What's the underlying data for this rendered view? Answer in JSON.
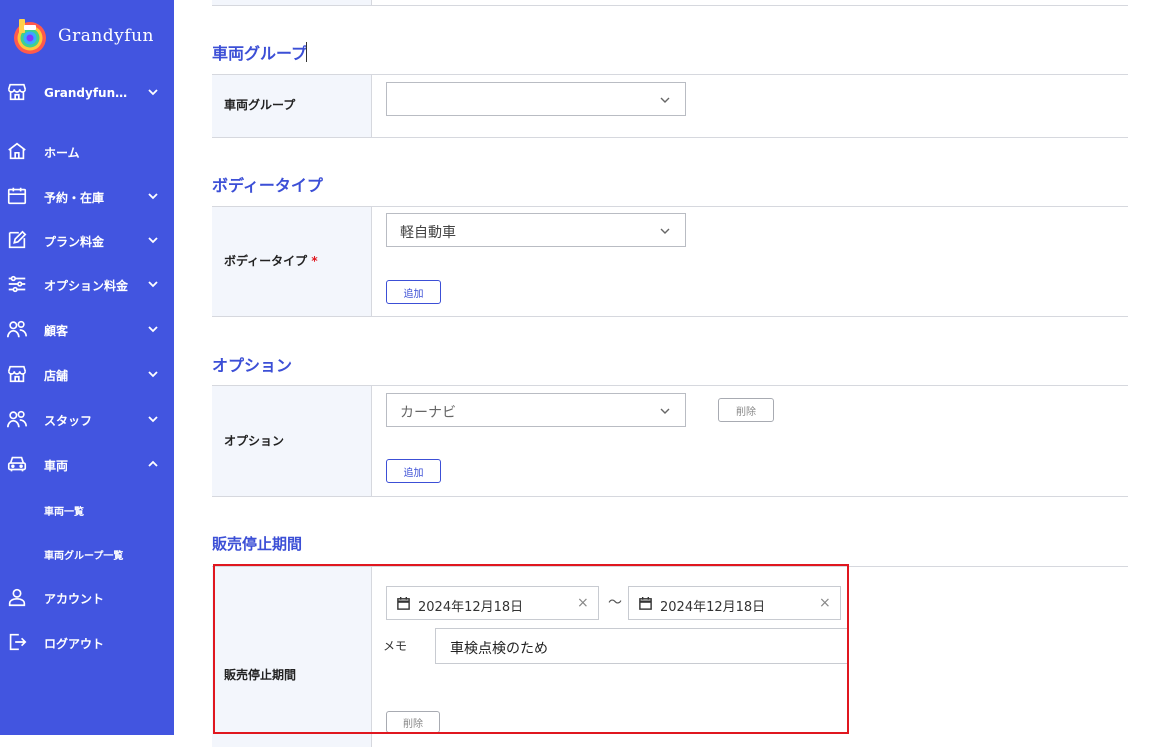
{
  "app": {
    "logo_text": "Grandyfun"
  },
  "sidebar": {
    "store": {
      "label": "Grandyfun…"
    },
    "items": [
      {
        "label": "ホーム"
      },
      {
        "label": "予約・在庫"
      },
      {
        "label": "プラン料金"
      },
      {
        "label": "オプション料金"
      },
      {
        "label": "顧客"
      },
      {
        "label": "店舗"
      },
      {
        "label": "スタッフ"
      },
      {
        "label": "車両"
      },
      {
        "label": "アカウント"
      },
      {
        "label": "ログアウト"
      }
    ],
    "sub_items": [
      {
        "label": "車両一覧"
      },
      {
        "label": "車両グループ一覧"
      }
    ],
    "colors": {
      "background": "#4255e0",
      "text": "#ffffff"
    }
  },
  "sections": {
    "vehicle_group": {
      "title": "車両グループ",
      "label": "車両グループ",
      "value": ""
    },
    "body_type": {
      "title": "ボディータイプ",
      "label": "ボディータイプ",
      "required_mark": "*",
      "value": "軽自動車",
      "add_label": "追加"
    },
    "option": {
      "title": "オプション",
      "label": "オプション",
      "value": "カーナビ",
      "delete_label": "削除",
      "add_label": "追加"
    },
    "sale_stop": {
      "title": "販売停止期間",
      "label": "販売停止期間",
      "start_date": "2024年12月18日",
      "separator": "～",
      "end_date": "2024年12月18日",
      "memo_label": "メモ",
      "memo_value": "車検点検のため",
      "delete_label": "削除"
    }
  },
  "colors": {
    "accent": "#3c4fd6",
    "highlight_border": "#e0171f",
    "required": "#e0171f"
  }
}
